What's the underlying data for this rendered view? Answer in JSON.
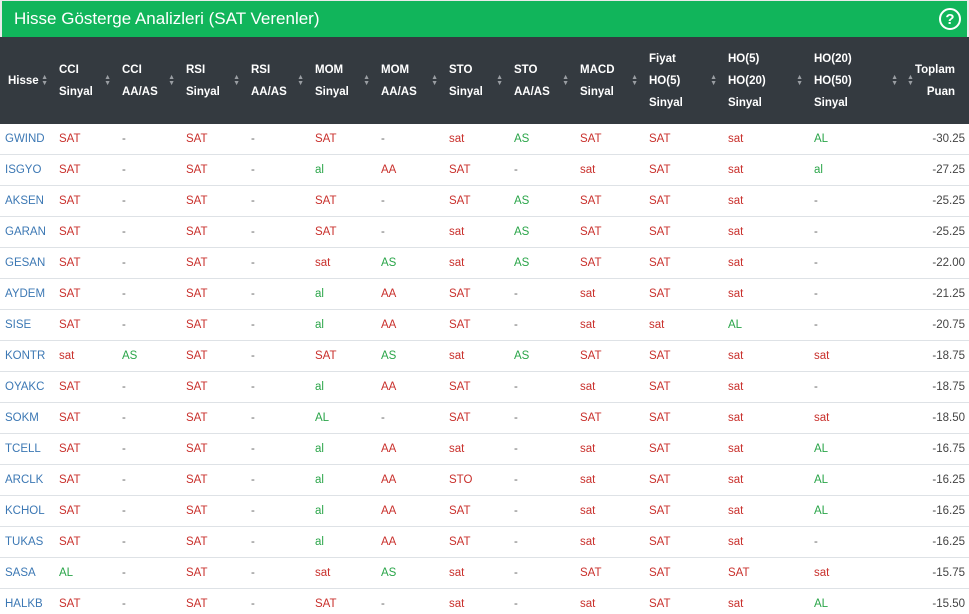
{
  "title": "Hisse Gösterge Analizleri (SAT Verenler)",
  "help_icon": "question-circle-icon",
  "colors": {
    "header_bg": "#11b55b",
    "table_head_bg": "#343a40",
    "sat": "#c9302c",
    "al": "#2aa549",
    "symbol": "#3c78b4"
  },
  "columns": [
    {
      "key": "sym",
      "lines": [
        "Hisse"
      ]
    },
    {
      "key": "cci_s",
      "lines": [
        "CCI",
        "Sinyal"
      ]
    },
    {
      "key": "cci_a",
      "lines": [
        "CCI",
        "AA/AS"
      ]
    },
    {
      "key": "rsi_s",
      "lines": [
        "RSI",
        "Sinyal"
      ]
    },
    {
      "key": "rsi_a",
      "lines": [
        "RSI",
        "AA/AS"
      ]
    },
    {
      "key": "mom_s",
      "lines": [
        "MOM",
        "Sinyal"
      ]
    },
    {
      "key": "mom_a",
      "lines": [
        "MOM",
        "AA/AS"
      ]
    },
    {
      "key": "sto_s",
      "lines": [
        "STO",
        "Sinyal"
      ]
    },
    {
      "key": "sto_a",
      "lines": [
        "STO",
        "AA/AS"
      ]
    },
    {
      "key": "macd",
      "lines": [
        "MACD",
        "Sinyal"
      ]
    },
    {
      "key": "fiyat",
      "lines": [
        "Fiyat",
        "HO(5)",
        "Sinyal"
      ]
    },
    {
      "key": "ho5",
      "lines": [
        "HO(5)",
        "HO(20)",
        "Sinyal"
      ]
    },
    {
      "key": "ho20",
      "lines": [
        "HO(20)",
        "HO(50)",
        "Sinyal"
      ]
    },
    {
      "key": "puan",
      "lines": [
        "Toplam",
        "Puan"
      ]
    }
  ],
  "rows": [
    [
      "GWIND",
      "SAT",
      "-",
      "SAT",
      "-",
      "SAT",
      "-",
      "sat",
      "AS",
      "SAT",
      "SAT",
      "sat",
      "AL",
      "-30.25"
    ],
    [
      "ISGYO",
      "SAT",
      "-",
      "SAT",
      "-",
      "al",
      "AA",
      "SAT",
      "-",
      "sat",
      "SAT",
      "sat",
      "al",
      "-27.25"
    ],
    [
      "AKSEN",
      "SAT",
      "-",
      "SAT",
      "-",
      "SAT",
      "-",
      "SAT",
      "AS",
      "SAT",
      "SAT",
      "sat",
      "-",
      "-25.25"
    ],
    [
      "GARAN",
      "SAT",
      "-",
      "SAT",
      "-",
      "SAT",
      "-",
      "sat",
      "AS",
      "SAT",
      "SAT",
      "sat",
      "-",
      "-25.25"
    ],
    [
      "GESAN",
      "SAT",
      "-",
      "SAT",
      "-",
      "sat",
      "AS",
      "sat",
      "AS",
      "SAT",
      "SAT",
      "sat",
      "-",
      "-22.00"
    ],
    [
      "AYDEM",
      "SAT",
      "-",
      "SAT",
      "-",
      "al",
      "AA",
      "SAT",
      "-",
      "sat",
      "SAT",
      "sat",
      "-",
      "-21.25"
    ],
    [
      "SISE",
      "SAT",
      "-",
      "SAT",
      "-",
      "al",
      "AA",
      "SAT",
      "-",
      "sat",
      "sat",
      "AL",
      "-",
      "-20.75"
    ],
    [
      "KONTR",
      "sat",
      "AS",
      "SAT",
      "-",
      "SAT",
      "AS",
      "sat",
      "AS",
      "SAT",
      "SAT",
      "sat",
      "sat",
      "-18.75"
    ],
    [
      "OYAKC",
      "SAT",
      "-",
      "SAT",
      "-",
      "al",
      "AA",
      "SAT",
      "-",
      "sat",
      "SAT",
      "sat",
      "-",
      "-18.75"
    ],
    [
      "SOKM",
      "SAT",
      "-",
      "SAT",
      "-",
      "AL",
      "-",
      "SAT",
      "-",
      "SAT",
      "SAT",
      "sat",
      "sat",
      "-18.50"
    ],
    [
      "TCELL",
      "SAT",
      "-",
      "SAT",
      "-",
      "al",
      "AA",
      "sat",
      "-",
      "sat",
      "SAT",
      "sat",
      "AL",
      "-16.75"
    ],
    [
      "ARCLK",
      "SAT",
      "-",
      "SAT",
      "-",
      "al",
      "AA",
      "STO",
      "-",
      "sat",
      "SAT",
      "sat",
      "AL",
      "-16.25"
    ],
    [
      "KCHOL",
      "SAT",
      "-",
      "SAT",
      "-",
      "al",
      "AA",
      "SAT",
      "-",
      "sat",
      "SAT",
      "sat",
      "AL",
      "-16.25"
    ],
    [
      "TUKAS",
      "SAT",
      "-",
      "SAT",
      "-",
      "al",
      "AA",
      "SAT",
      "-",
      "sat",
      "SAT",
      "sat",
      "-",
      "-16.25"
    ],
    [
      "SASA",
      "AL",
      "-",
      "SAT",
      "-",
      "sat",
      "AS",
      "sat",
      "-",
      "SAT",
      "SAT",
      "SAT",
      "sat",
      "-15.75"
    ],
    [
      "HALKB",
      "SAT",
      "-",
      "SAT",
      "-",
      "SAT",
      "-",
      "sat",
      "-",
      "sat",
      "SAT",
      "sat",
      "AL",
      "-15.50"
    ]
  ]
}
